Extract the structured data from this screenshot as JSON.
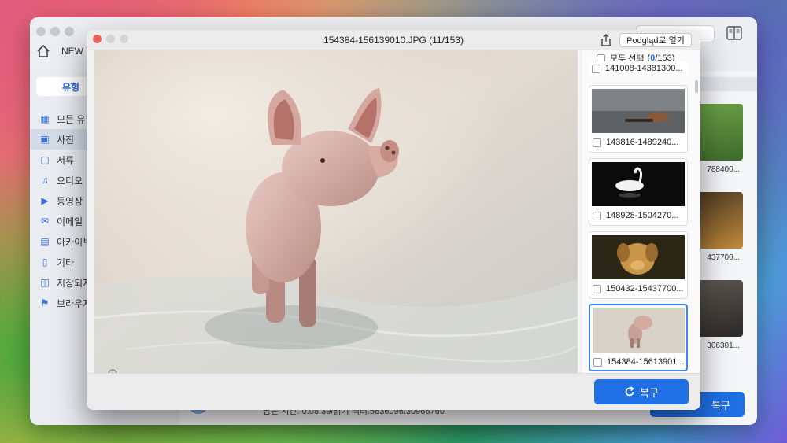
{
  "app": {
    "title": "NEW V",
    "type_tab": "유형",
    "sidebar": [
      {
        "label": "모든 유형",
        "icon": "grid-icon"
      },
      {
        "label": "사진",
        "icon": "photo-icon",
        "active": true
      },
      {
        "label": "서류",
        "icon": "document-icon"
      },
      {
        "label": "오디오",
        "icon": "music-icon"
      },
      {
        "label": "동영상",
        "icon": "video-icon"
      },
      {
        "label": "이메일",
        "icon": "mail-icon"
      },
      {
        "label": "아카이브",
        "icon": "archive-icon"
      },
      {
        "label": "기타",
        "icon": "file-icon"
      },
      {
        "label": "저장되지",
        "icon": "save-icon"
      },
      {
        "label": "브라우저",
        "icon": "bookmark-icon"
      }
    ],
    "status_text": "남은 시간: 0:08:39/읽기 섹터:5636096/30965760",
    "recover_label": "복구",
    "bg_labels": [
      "788400...",
      "437700...",
      "306301..."
    ]
  },
  "modal": {
    "title": "154384-156139010.JPG (11/153)",
    "open_label": "Podgląd로 열기",
    "select_all_label": "모두 선택",
    "selected_count": "0",
    "total_count": "/153",
    "partial_item": "141008-14381300...",
    "items": [
      {
        "caption": "143816-1489240...",
        "thumb": "snail",
        "selected": false
      },
      {
        "caption": "148928-1504270...",
        "thumb": "swan",
        "selected": false
      },
      {
        "caption": "150432-15437700...",
        "thumb": "dog",
        "selected": false
      },
      {
        "caption": "154384-15613901...",
        "thumb": "pig",
        "selected": true
      }
    ],
    "recover_label": "복구"
  },
  "colors": {
    "accent": "#1f6fe5",
    "selection": "#3f86f0",
    "sidebar_active": "#d3dbe8"
  }
}
